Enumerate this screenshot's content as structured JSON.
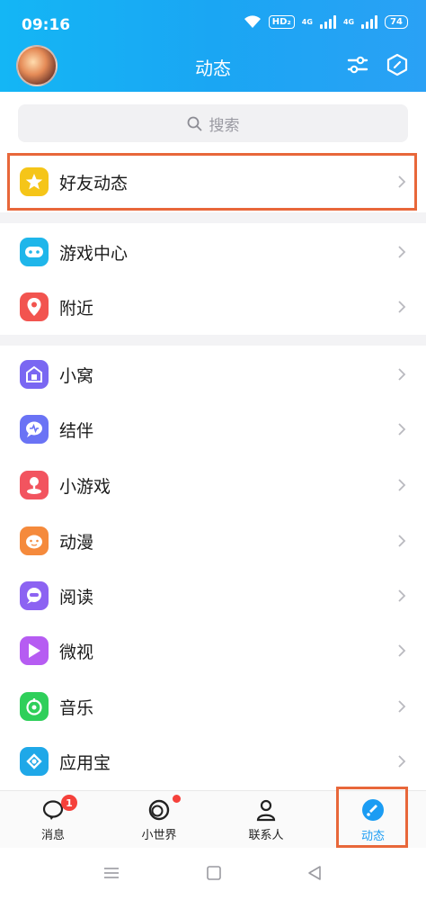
{
  "status": {
    "time": "09:16",
    "hd": "HD₂",
    "battery": "74",
    "net1": "4G",
    "net2": "4G"
  },
  "header": {
    "title": "动态"
  },
  "search": {
    "placeholder": "搜索"
  },
  "menu": [
    {
      "label": "好友动态",
      "icon": "star-icon",
      "color": "#f5c518"
    },
    {
      "label": "游戏中心",
      "icon": "gamepad-icon",
      "color": "#1fb6ea"
    },
    {
      "label": "附近",
      "icon": "location-pin-icon",
      "color": "#f2544f"
    },
    {
      "label": "小窝",
      "icon": "home-icon",
      "color": "#7a67f2"
    },
    {
      "label": "结伴",
      "icon": "chat-heart-icon",
      "color": "#6a73f5"
    },
    {
      "label": "小游戏",
      "icon": "joystick-icon",
      "color": "#f2545f"
    },
    {
      "label": "动漫",
      "icon": "anime-face-icon",
      "color": "#f58a3c"
    },
    {
      "label": "阅读",
      "icon": "reader-icon",
      "color": "#8c63f2"
    },
    {
      "label": "微视",
      "icon": "play-icon",
      "color": "#b65cf2"
    },
    {
      "label": "音乐",
      "icon": "music-icon",
      "color": "#2fcf5a"
    },
    {
      "label": "应用宝",
      "icon": "appstore-icon",
      "color": "#1fa8e8"
    }
  ],
  "nav": {
    "messages": {
      "label": "消息",
      "badge": "1"
    },
    "world": {
      "label": "小世界"
    },
    "contacts": {
      "label": "联系人"
    },
    "moments": {
      "label": "动态"
    }
  },
  "colors": {
    "accent": "#1b9cf3",
    "highlight": "#e8673a"
  }
}
